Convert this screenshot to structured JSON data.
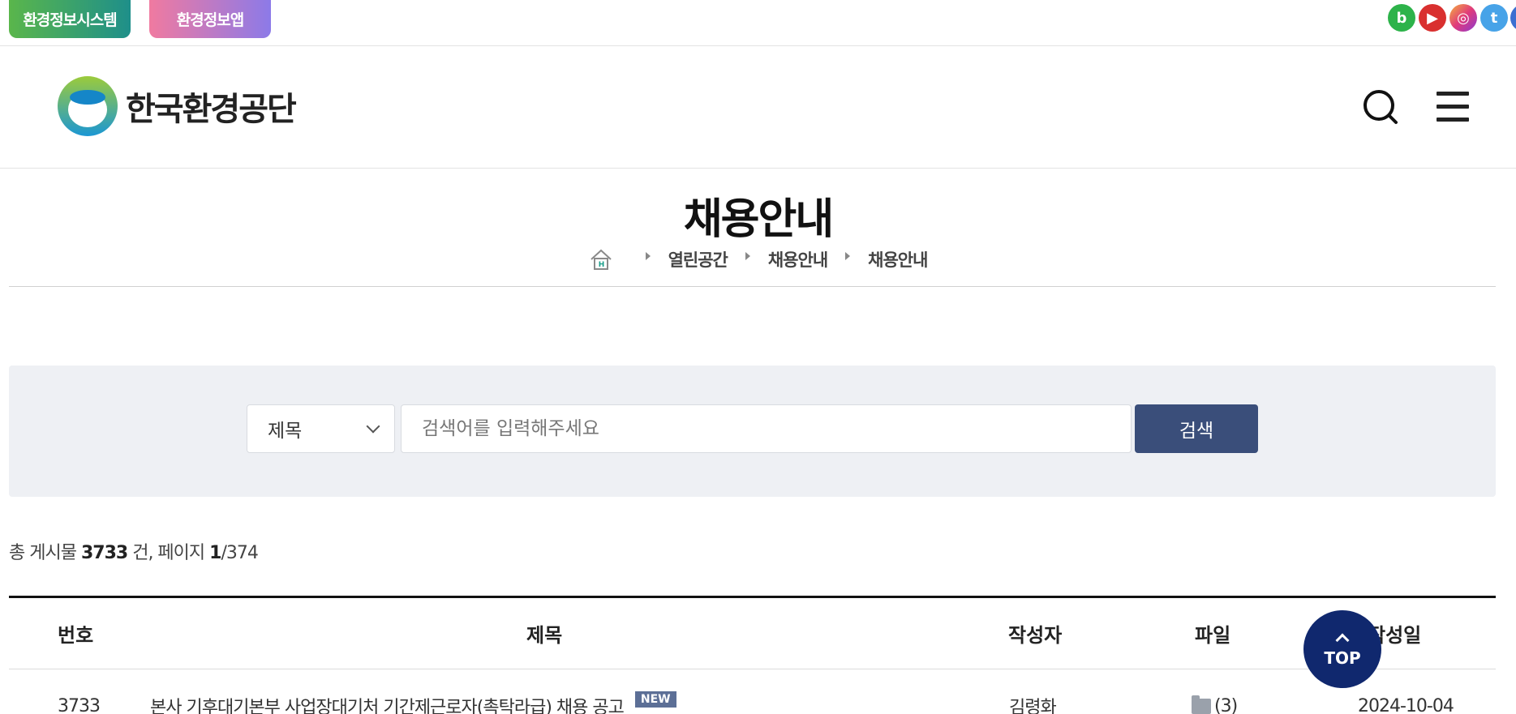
{
  "topbar": {
    "system_link": "환경정보시스템",
    "app_link": "환경정보앱",
    "social": [
      {
        "name": "blog-icon",
        "glyph": "b",
        "color": "#2db34a"
      },
      {
        "name": "youtube-icon",
        "glyph": "▶",
        "color": "#d9302f"
      },
      {
        "name": "instagram-icon",
        "glyph": "◎",
        "color": "#e03a7b"
      },
      {
        "name": "twitter-icon",
        "glyph": "t",
        "color": "#47a3e8"
      },
      {
        "name": "more-social-icon",
        "glyph": "f",
        "color": "#3c6fd1"
      }
    ]
  },
  "header": {
    "logo_text": "한국환경공단",
    "search_icon": "search-icon",
    "menu_icon": "hamburger-menu-icon"
  },
  "page": {
    "title": "채용안내",
    "breadcrumb": [
      "열린공간",
      "채용안내",
      "채용안내"
    ]
  },
  "search": {
    "field_select": "제목",
    "placeholder": "검색어를 입력해주세요",
    "button": "검색"
  },
  "summary": {
    "prefix": "총 게시물",
    "total": "3733",
    "unit": "건, 페이지",
    "current_page": "1",
    "total_pages": "/374"
  },
  "table": {
    "headers": {
      "no": "번호",
      "title": "제목",
      "writer": "작성자",
      "file": "파일",
      "date": "작성일"
    },
    "rows": [
      {
        "no": "3733",
        "title": "본사 기후대기본부 사업장대기처 기간제근로자(촉탁라급) 채용 공고",
        "badge": "NEW",
        "writer": "김령화",
        "files": "(3)",
        "date": "2024-10-04"
      }
    ]
  },
  "top_button": "TOP",
  "colors": {
    "primary_button": "#3a4e7a",
    "top_button": "#10286e",
    "new_badge": "#5c6f96"
  }
}
